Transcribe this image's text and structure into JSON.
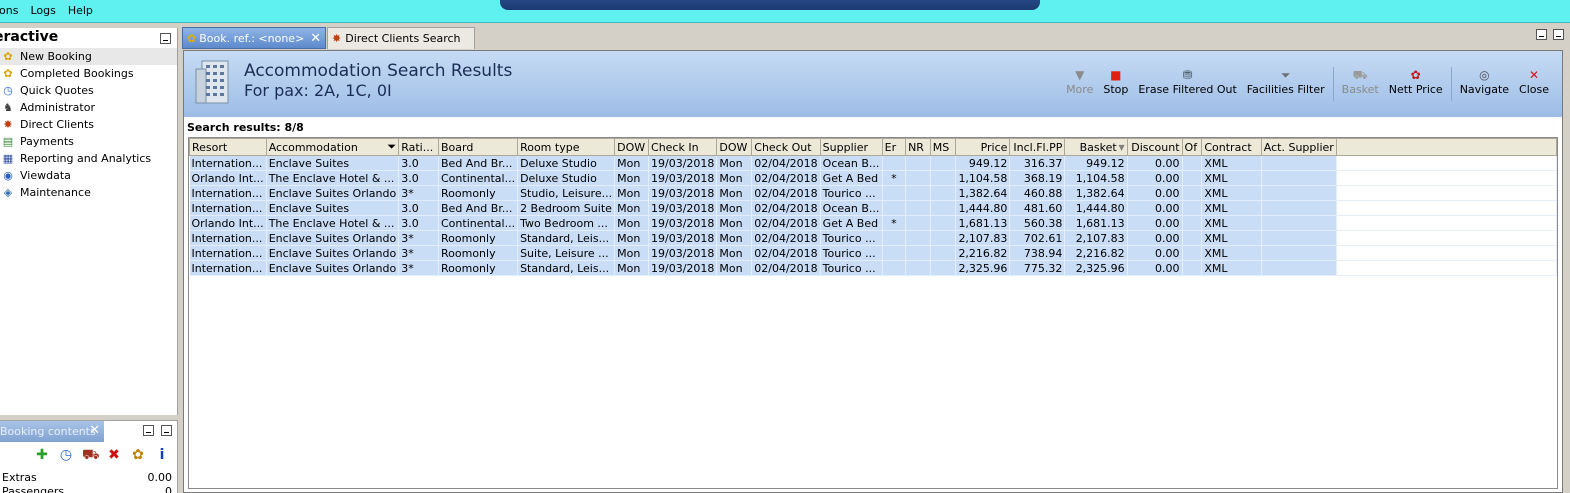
{
  "menu": [
    "ons",
    "Logs",
    "Help"
  ],
  "left": {
    "title": "eractive",
    "items": [
      {
        "label": "New Booking",
        "icon": "palm-tree-icon",
        "selected": true
      },
      {
        "label": "Completed Bookings",
        "icon": "palm-tree-icon"
      },
      {
        "label": "Quick Quotes",
        "icon": "clock-icon"
      },
      {
        "label": "Administrator",
        "icon": "person-icon"
      },
      {
        "label": "Direct Clients",
        "icon": "clients-icon"
      },
      {
        "label": "Payments",
        "icon": "payments-icon"
      },
      {
        "label": "Reporting and Analytics",
        "icon": "report-icon"
      },
      {
        "label": "Viewdata",
        "icon": "globe-icon"
      },
      {
        "label": "Maintenance",
        "icon": "maintenance-icon"
      }
    ]
  },
  "booking": {
    "tab": "Booking contents",
    "rows": [
      {
        "label": "Extras",
        "value": "0.00"
      },
      {
        "label": "Passengers",
        "value": "0"
      }
    ]
  },
  "tabs": [
    {
      "label": "Book. ref.: <none>"
    },
    {
      "label": "Direct Clients Search"
    }
  ],
  "header": {
    "title": "Accommodation Search Results",
    "subtitle": "For pax: 2A, 1C, 0I"
  },
  "toolbar": [
    {
      "label": "More",
      "icon": "triangle-down-icon",
      "disabled": true
    },
    {
      "label": "Stop",
      "icon": "stop-icon"
    },
    {
      "label": "Erase Filtered Out",
      "icon": "erase-icon"
    },
    {
      "label": "Facilities Filter",
      "icon": "filter-icon"
    },
    {
      "label": "Basket",
      "icon": "basket-icon",
      "disabled": true
    },
    {
      "label": "Nett Price",
      "icon": "nett-price-icon"
    },
    {
      "label": "Navigate",
      "icon": "navigate-icon"
    },
    {
      "label": "Close",
      "icon": "close-icon"
    }
  ],
  "results_label": "Search results: 8/8",
  "columns": [
    "Resort",
    "Accommodation",
    "Rati...",
    "Board",
    "Room type",
    "DOW",
    "Check In",
    "DOW",
    "Check Out",
    "Supplier",
    "Er",
    "NR",
    "MS",
    "Price",
    "Incl.Fl.PP",
    "Basket",
    "Discount",
    "Of",
    "Contract",
    "Act. Supplier"
  ],
  "rows": [
    [
      "Internation...",
      "Enclave Suites",
      "3.0",
      "Bed And Br...",
      "Deluxe Studio",
      "Mon",
      "19/03/2018",
      "Mon",
      "02/04/2018",
      "Ocean B...",
      "",
      "",
      "",
      "949.12",
      "316.37",
      "949.12",
      "0.00",
      "",
      "XML",
      ""
    ],
    [
      "Orlando Int...",
      "The Enclave Hotel & ...",
      "3.0",
      "Continental...",
      "Deluxe Studio",
      "Mon",
      "19/03/2018",
      "Mon",
      "02/04/2018",
      "Get A Bed",
      "*",
      "",
      "",
      "1,104.58",
      "368.19",
      "1,104.58",
      "0.00",
      "",
      "XML",
      ""
    ],
    [
      "Internation...",
      "Enclave Suites Orlando",
      "3*",
      "Roomonly",
      "Studio, Leisure...",
      "Mon",
      "19/03/2018",
      "Mon",
      "02/04/2018",
      "Tourico ...",
      "",
      "",
      "",
      "1,382.64",
      "460.88",
      "1,382.64",
      "0.00",
      "",
      "XML",
      ""
    ],
    [
      "Internation...",
      "Enclave Suites",
      "3.0",
      "Bed And Br...",
      "2 Bedroom Suite",
      "Mon",
      "19/03/2018",
      "Mon",
      "02/04/2018",
      "Ocean B...",
      "",
      "",
      "",
      "1,444.80",
      "481.60",
      "1,444.80",
      "0.00",
      "",
      "XML",
      ""
    ],
    [
      "Orlando Int...",
      "The Enclave Hotel & ...",
      "3.0",
      "Continental...",
      "Two Bedroom ...",
      "Mon",
      "19/03/2018",
      "Mon",
      "02/04/2018",
      "Get A Bed",
      "*",
      "",
      "",
      "1,681.13",
      "560.38",
      "1,681.13",
      "0.00",
      "",
      "XML",
      ""
    ],
    [
      "Internation...",
      "Enclave Suites Orlando",
      "3*",
      "Roomonly",
      "Standard, Leis...",
      "Mon",
      "19/03/2018",
      "Mon",
      "02/04/2018",
      "Tourico ...",
      "",
      "",
      "",
      "2,107.83",
      "702.61",
      "2,107.83",
      "0.00",
      "",
      "XML",
      ""
    ],
    [
      "Internation...",
      "Enclave Suites Orlando",
      "3*",
      "Roomonly",
      "Suite, Leisure ...",
      "Mon",
      "19/03/2018",
      "Mon",
      "02/04/2018",
      "Tourico ...",
      "",
      "",
      "",
      "2,216.82",
      "738.94",
      "2,216.82",
      "0.00",
      "",
      "XML",
      ""
    ],
    [
      "Internation...",
      "Enclave Suites Orlando",
      "3*",
      "Roomonly",
      "Standard, Leis...",
      "Mon",
      "19/03/2018",
      "Mon",
      "02/04/2018",
      "Tourico ...",
      "",
      "",
      "",
      "2,325.96",
      "775.32",
      "2,325.96",
      "0.00",
      "",
      "XML",
      ""
    ]
  ]
}
